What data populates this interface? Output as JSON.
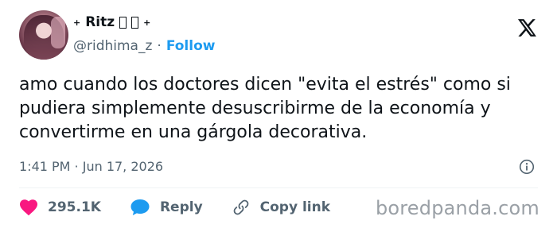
{
  "author": {
    "display_name": "Ritz",
    "handle": "@ridhima_z",
    "separator": "·",
    "follow_label": "Follow",
    "sparkle": "+"
  },
  "tweet": {
    "text": "amo cuando los doctores dicen \"evita el estrés\" como si pudiera simplemente desuscribirme de la economía y convertirme en una gárgola decorativa.",
    "timestamp": "1:41 PM · Jun 17, 2026"
  },
  "actions": {
    "likes": "295.1K",
    "reply_label": "Reply",
    "copy_link_label": "Copy link"
  },
  "watermark": "boredpanda.com",
  "colors": {
    "accent": "#1d9bf0",
    "like": "#f91880",
    "text": "#0f1419",
    "muted": "#536471"
  },
  "icons": [
    "x-logo-icon",
    "info-icon",
    "heart-icon",
    "reply-bubble-icon",
    "link-icon"
  ]
}
